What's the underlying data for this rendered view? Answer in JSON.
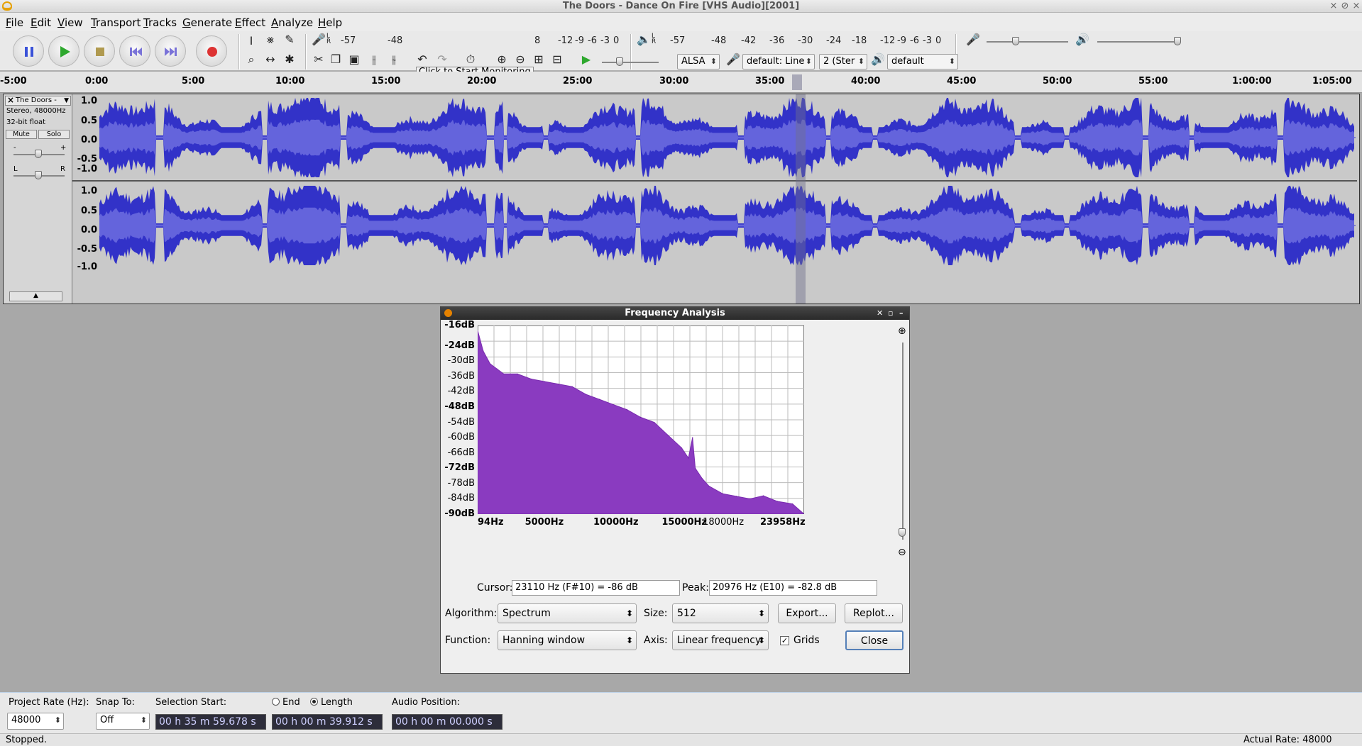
{
  "window": {
    "title": "The Doors - Dance On Fire [VHS Audio][2001]",
    "controls": [
      "×",
      "⊘",
      "×"
    ]
  },
  "menu": [
    "File",
    "Edit",
    "View",
    "Transport",
    "Tracks",
    "Generate",
    "Effect",
    "Analyze",
    "Help"
  ],
  "toolbar": {
    "rec_meter_ticks": [
      "-57",
      "-48",
      "-12",
      "-9",
      "-6",
      "-3",
      "0"
    ],
    "rec_meter_tick_mid": "8",
    "monitor_label": "Click to Start Monitoring",
    "play_meter_ticks": [
      "-57",
      "-48",
      "-42",
      "-36",
      "-30",
      "-24",
      "-18",
      "-12",
      "-9",
      "-6",
      "-3",
      "0"
    ],
    "lr_label": "L\nR",
    "host": "ALSA",
    "recording_device": "default: Line",
    "channels": "2 (Ster",
    "playback_device": "default"
  },
  "ruler": {
    "labels": [
      "-5:00",
      "0:00",
      "5:00",
      "10:00",
      "15:00",
      "20:00",
      "25:00",
      "30:00",
      "35:00",
      "40:00",
      "45:00",
      "50:00",
      "55:00",
      "1:00:00",
      "1:05:00"
    ]
  },
  "track": {
    "name": "The Doors -",
    "info1": "Stereo, 48000Hz",
    "info2": "32-bit float",
    "mute": "Mute",
    "solo": "Solo",
    "gain_minus": "-",
    "gain_plus": "+",
    "pan_l": "L",
    "pan_r": "R",
    "collapse": "▲",
    "amp_labels": [
      "1.0",
      "0.5",
      "0.0",
      "-0.5",
      "-1.0"
    ]
  },
  "dialog": {
    "title": "Frequency Analysis",
    "cursor_label": "Cursor:",
    "cursor_value": "23110 Hz (F#10) = -86 dB",
    "peak_label": "Peak:",
    "peak_value": "20976 Hz (E10) = -82.8 dB",
    "algorithm_label": "Algorithm:",
    "algorithm_value": "Spectrum",
    "size_label": "Size:",
    "size_value": "512",
    "export_label": "Export...",
    "replot_label": "Replot...",
    "function_label": "Function:",
    "function_value": "Hanning window",
    "axis_label": "Axis:",
    "axis_value": "Linear frequency",
    "grids_label": "Grids",
    "close_label": "Close"
  },
  "chart_data": {
    "type": "area",
    "title": "",
    "xlabel": "",
    "ylabel": "",
    "x_tick_labels": [
      "94Hz",
      "5000Hz",
      "10000Hz",
      "15000Hz",
      "18000Hz",
      "23958Hz"
    ],
    "y_tick_labels": [
      "-16dB",
      "-24dB",
      "-30dB",
      "-36dB",
      "-42dB",
      "-48dB",
      "-54dB",
      "-60dB",
      "-66dB",
      "-72dB",
      "-78dB",
      "-84dB",
      "-90dB"
    ],
    "xlim": [
      94,
      23958
    ],
    "ylim": [
      -90,
      -16
    ],
    "grid": true,
    "color": "#8a3bc0",
    "x": [
      94,
      500,
      1000,
      1500,
      2000,
      3000,
      4000,
      5000,
      6000,
      7000,
      8000,
      9000,
      10000,
      11000,
      12000,
      13000,
      14000,
      15000,
      15500,
      15800,
      16000,
      16500,
      17000,
      18000,
      19000,
      20000,
      20976,
      22000,
      23110,
      23958
    ],
    "values": [
      -18,
      -26,
      -31,
      -33,
      -35,
      -35,
      -37,
      -38,
      -39,
      -40,
      -43,
      -45,
      -47,
      -49,
      -52,
      -54,
      -59,
      -64,
      -68,
      -60,
      -72,
      -76,
      -79,
      -82,
      -83,
      -84,
      -82.8,
      -85,
      -86,
      -90
    ]
  },
  "bottom": {
    "project_rate_label": "Project Rate (Hz):",
    "project_rate": "48000",
    "snap_label": "Snap To:",
    "snap_value": "Off",
    "selection_start_label": "Selection Start:",
    "end_label": "End",
    "length_label": "Length",
    "selection_start": "00 h 35 m 59.678 s",
    "length": "00 h 00 m 39.912 s",
    "audio_position_label": "Audio Position:",
    "audio_position": "00 h 00 m 00.000 s"
  },
  "status": {
    "left": "Stopped.",
    "right": "Actual Rate: 48000"
  }
}
